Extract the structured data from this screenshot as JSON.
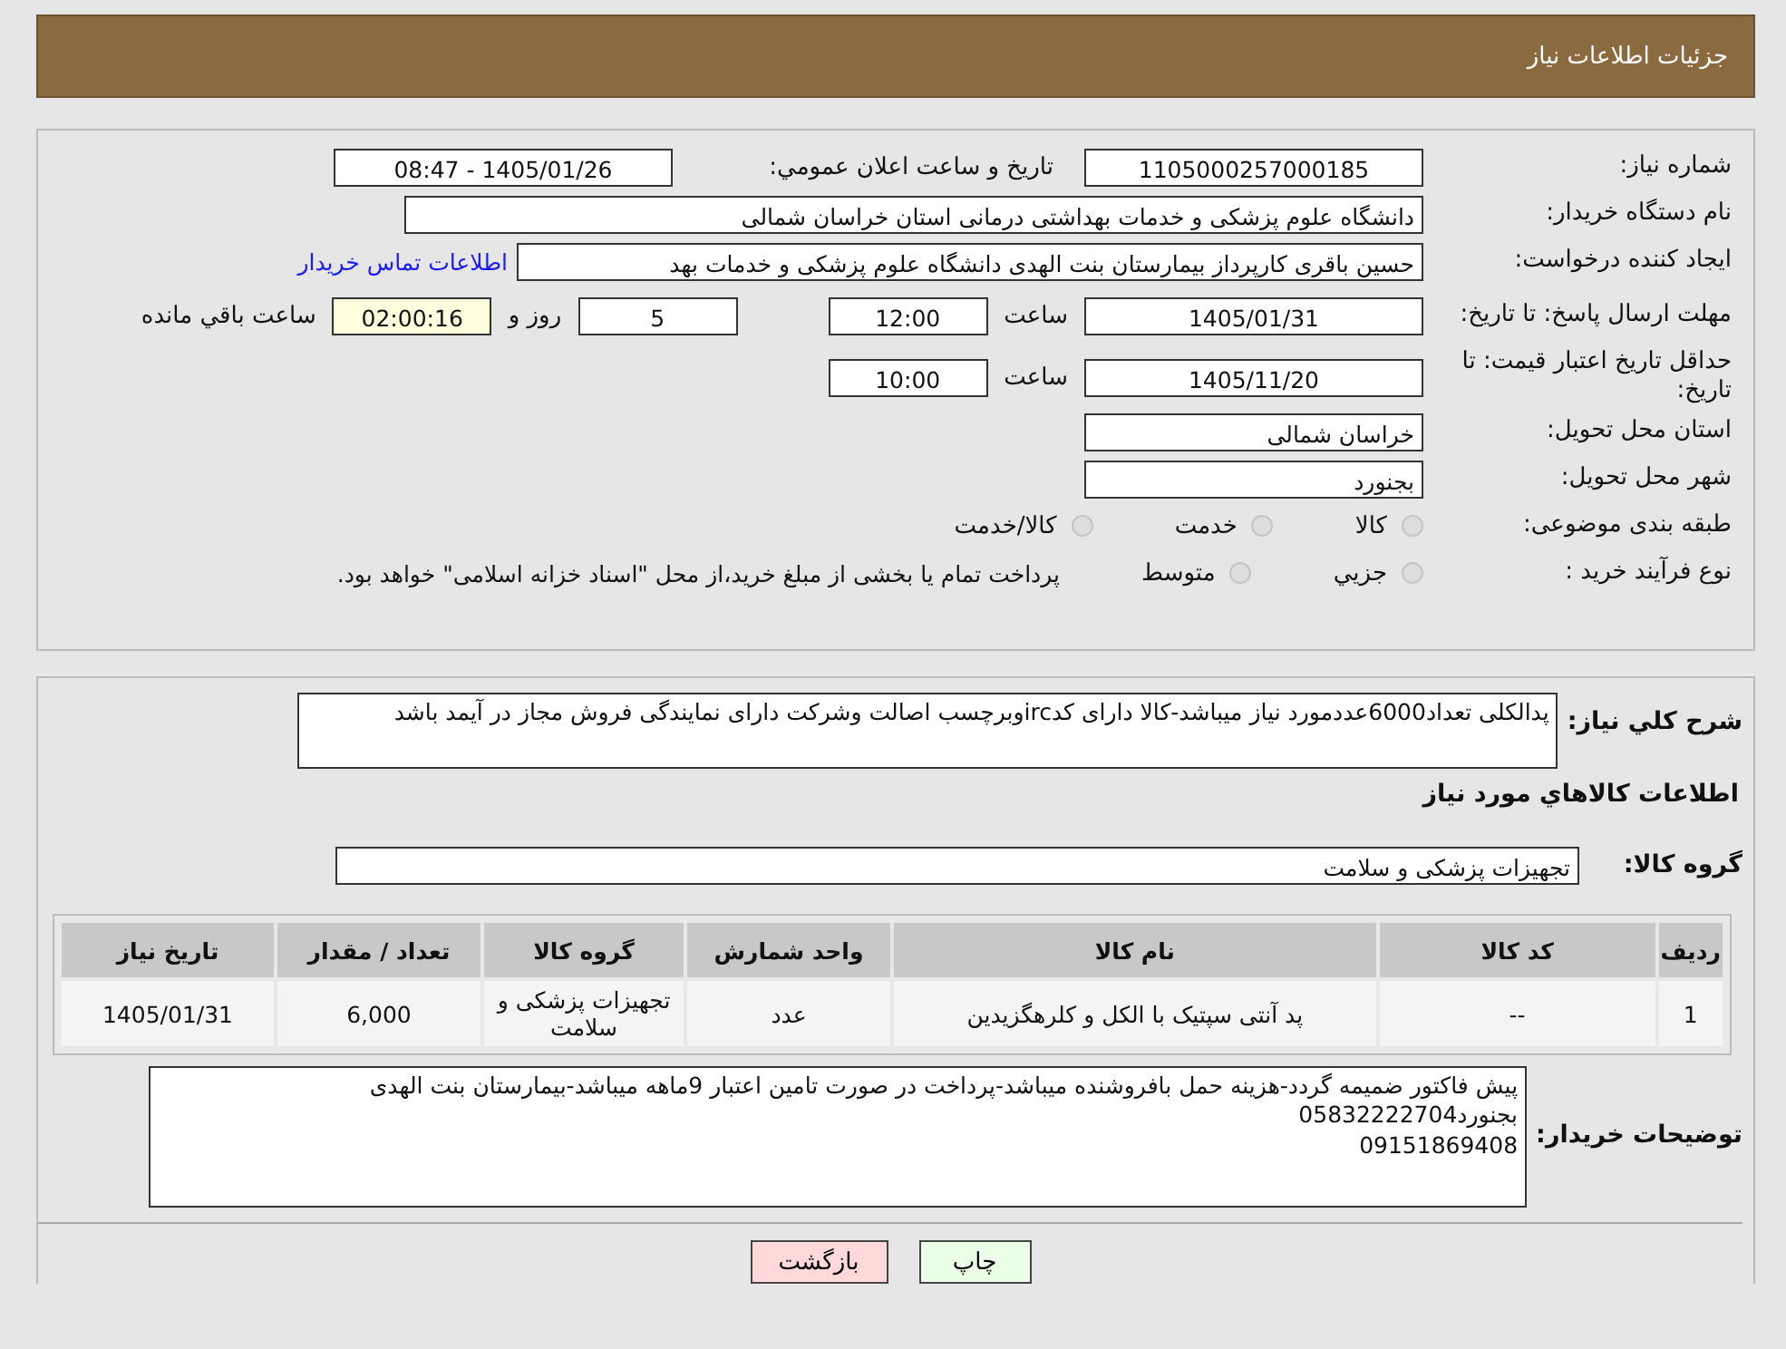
{
  "header": {
    "title": "جزئیات اطلاعات نیاز"
  },
  "need_number": {
    "label": "شماره نیاز:",
    "value": "1105000257000185"
  },
  "announce": {
    "label": "تاریخ و ساعت اعلان عمومي:",
    "value": "1405/01/26 - 08:47"
  },
  "buyer_org": {
    "label": "نام دستگاه خریدار:",
    "value": "دانشگاه علوم پزشکی و خدمات بهداشتی درمانی استان خراسان شمالی"
  },
  "requester": {
    "label": "ایجاد کننده درخواست:",
    "value": "حسین باقری کارپرداز بیمارستان بنت الهدی دانشگاه علوم پزشکی و خدمات بهد",
    "contact_link": "اطلاعات تماس خریدار"
  },
  "deadline": {
    "label": "مهلت ارسال پاسخ: تا تاریخ:",
    "date": "1405/01/31",
    "time_label": "ساعت",
    "time": "12:00",
    "days": "5",
    "days_label": "روز و",
    "remaining": "02:00:16",
    "remaining_label": "ساعت باقي مانده"
  },
  "price_validity": {
    "label": "حداقل تاریخ اعتبار قیمت: تا تاریخ:",
    "date": "1405/11/20",
    "time_label": "ساعت",
    "time": "10:00"
  },
  "province": {
    "label": "استان محل تحویل:",
    "value": "خراسان شمالی"
  },
  "city": {
    "label": "شهر محل تحویل:",
    "value": "بجنورد"
  },
  "category": {
    "label": "طبقه بندی موضوعی:",
    "options": [
      {
        "label": "کالا",
        "selected": false
      },
      {
        "label": "خدمت",
        "selected": false
      },
      {
        "label": "کالا/خدمت",
        "selected": false
      }
    ]
  },
  "purchase_type": {
    "label": "نوع فرآیند خرید :",
    "options": [
      {
        "label": "جزيي",
        "selected": false
      },
      {
        "label": "متوسط",
        "selected": false
      }
    ],
    "note": "پرداخت تمام یا بخشی از مبلغ خرید،از محل \"اسناد خزانه اسلامی\" خواهد بود."
  },
  "description": {
    "label": "شرح كلي نياز:",
    "value": "پدالکلی تعداد6000عددمورد نیاز میباشد-کالا دارای کدircوبرچسب اصالت وشرکت دارای نمایندگی فروش مجاز در آیمد باشد"
  },
  "goods_title": "اطلاعات كالاهاي مورد نياز",
  "goods_group": {
    "label": "گروه کالا:",
    "value": "تجهیزات پزشکی و سلامت"
  },
  "table": {
    "columns": [
      "ردیف",
      "کد کالا",
      "نام کالا",
      "واحد شمارش",
      "گروه کالا",
      "تعداد / مقدار",
      "تاریخ نیاز"
    ],
    "rows": [
      [
        "1",
        "--",
        "پد آنتی سپتیک با الکل و کلرهگزیدین",
        "عدد",
        "تجهیزات پزشکی و سلامت",
        "6,000",
        "1405/01/31"
      ]
    ]
  },
  "buyer_notes": {
    "label": "توضیحات خریدار:",
    "lines": [
      "پیش فاکتور ضمیمه گردد-هزینه حمل بافروشنده میباشد-پرداخت در صورت تامین اعتبار 9ماهه میباشد-بیمارستان بنت الهدی بجنورد05832222704",
      "09151869408"
    ]
  },
  "buttons": [
    {
      "label": "چاپ",
      "kind": "print"
    },
    {
      "label": "بازگشت",
      "kind": "back"
    }
  ]
}
